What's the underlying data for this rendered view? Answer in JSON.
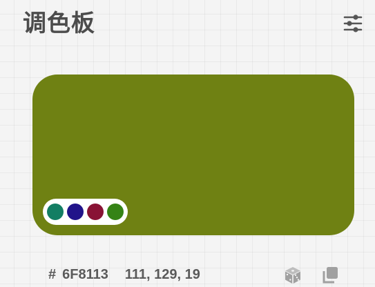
{
  "header": {
    "title": "调色板",
    "settings_icon": "tune-sliders-icon"
  },
  "card": {
    "color": "#6F8113",
    "palette": [
      {
        "color": "#137E63"
      },
      {
        "color": "#21148A"
      },
      {
        "color": "#891335"
      },
      {
        "color": "#358316"
      }
    ]
  },
  "info": {
    "hash": "#",
    "hex": "6F8113",
    "rgb": "111, 129, 19"
  },
  "actions": {
    "random_icon": "dice-icon",
    "copy_icon": "copy-icon",
    "icon_color": "#a0a0a0"
  }
}
